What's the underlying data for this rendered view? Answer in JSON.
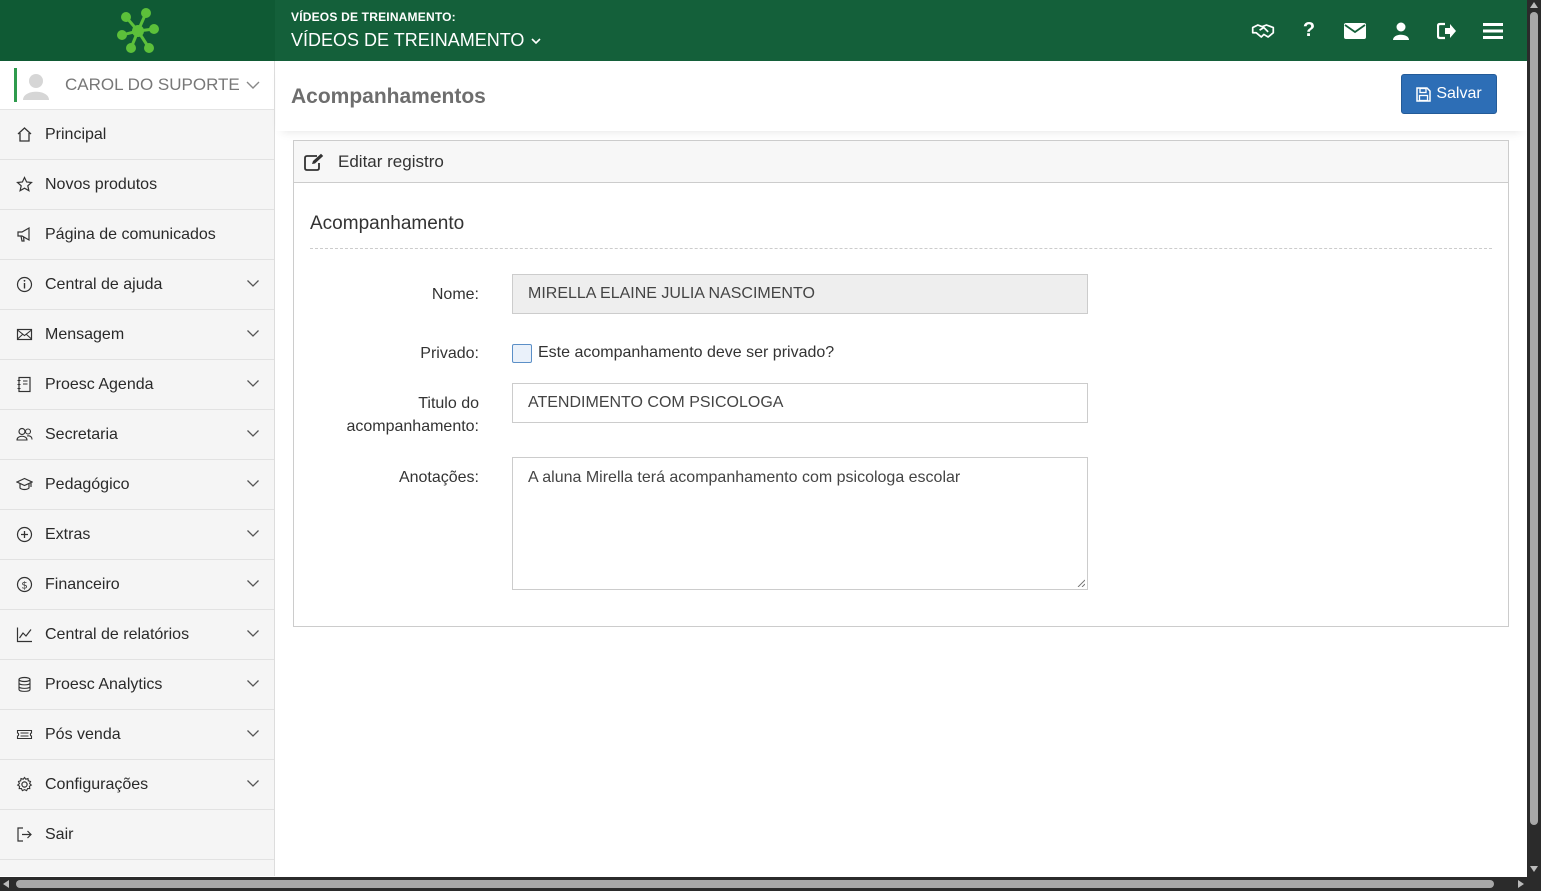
{
  "header": {
    "subtitle": "VÍDEOS DE TREINAMENTO:",
    "title": "VÍDEOS DE TREINAMENTO",
    "icons": [
      "handshake-icon",
      "help-icon",
      "envelope-icon",
      "user-icon",
      "logout-icon",
      "menu-icon"
    ]
  },
  "user": {
    "name": "CAROL DO SUPORTE"
  },
  "sidebar": {
    "items": [
      {
        "label": "Principal",
        "icon": "home-icon",
        "expandable": false
      },
      {
        "label": "Novos produtos",
        "icon": "star-icon",
        "expandable": false
      },
      {
        "label": "Página de comunicados",
        "icon": "megaphone-icon",
        "expandable": false
      },
      {
        "label": "Central de ajuda",
        "icon": "info-icon",
        "expandable": true
      },
      {
        "label": "Mensagem",
        "icon": "mail-icon",
        "expandable": true
      },
      {
        "label": "Proesc Agenda",
        "icon": "agenda-icon",
        "expandable": true
      },
      {
        "label": "Secretaria",
        "icon": "users-icon",
        "expandable": true
      },
      {
        "label": "Pedagógico",
        "icon": "graduation-icon",
        "expandable": true
      },
      {
        "label": "Extras",
        "icon": "plus-circle-icon",
        "expandable": true
      },
      {
        "label": "Financeiro",
        "icon": "dollar-icon",
        "expandable": true
      },
      {
        "label": "Central de relatórios",
        "icon": "chart-icon",
        "expandable": true
      },
      {
        "label": "Proesc Analytics",
        "icon": "database-icon",
        "expandable": true
      },
      {
        "label": "Pós venda",
        "icon": "ticket-icon",
        "expandable": true
      },
      {
        "label": "Configurações",
        "icon": "gear-icon",
        "expandable": true
      },
      {
        "label": "Sair",
        "icon": "exit-icon",
        "expandable": false
      }
    ]
  },
  "page": {
    "title": "Acompanhamentos",
    "save_label": "Salvar"
  },
  "panel": {
    "heading": "Editar registro",
    "section_title": "Acompanhamento"
  },
  "form": {
    "name_label": "Nome:",
    "name_value": "MIRELLA ELAINE JULIA NASCIMENTO",
    "private_label": "Privado:",
    "private_checkbox_label": "Este acompanhamento deve ser privado?",
    "private_checked": false,
    "title_label_line1": "Titulo do",
    "title_label_line2": "acompanhamento:",
    "title_value": "ATENDIMENTO COM PSICOLOGA",
    "notes_label": "Anotações:",
    "notes_value": "A aluna Mirella terá acompanhamento com psicologa escolar"
  },
  "colors": {
    "topbar": "#14603a",
    "accent_green": "#2e9b4d",
    "save_button": "#2d6eb6"
  }
}
